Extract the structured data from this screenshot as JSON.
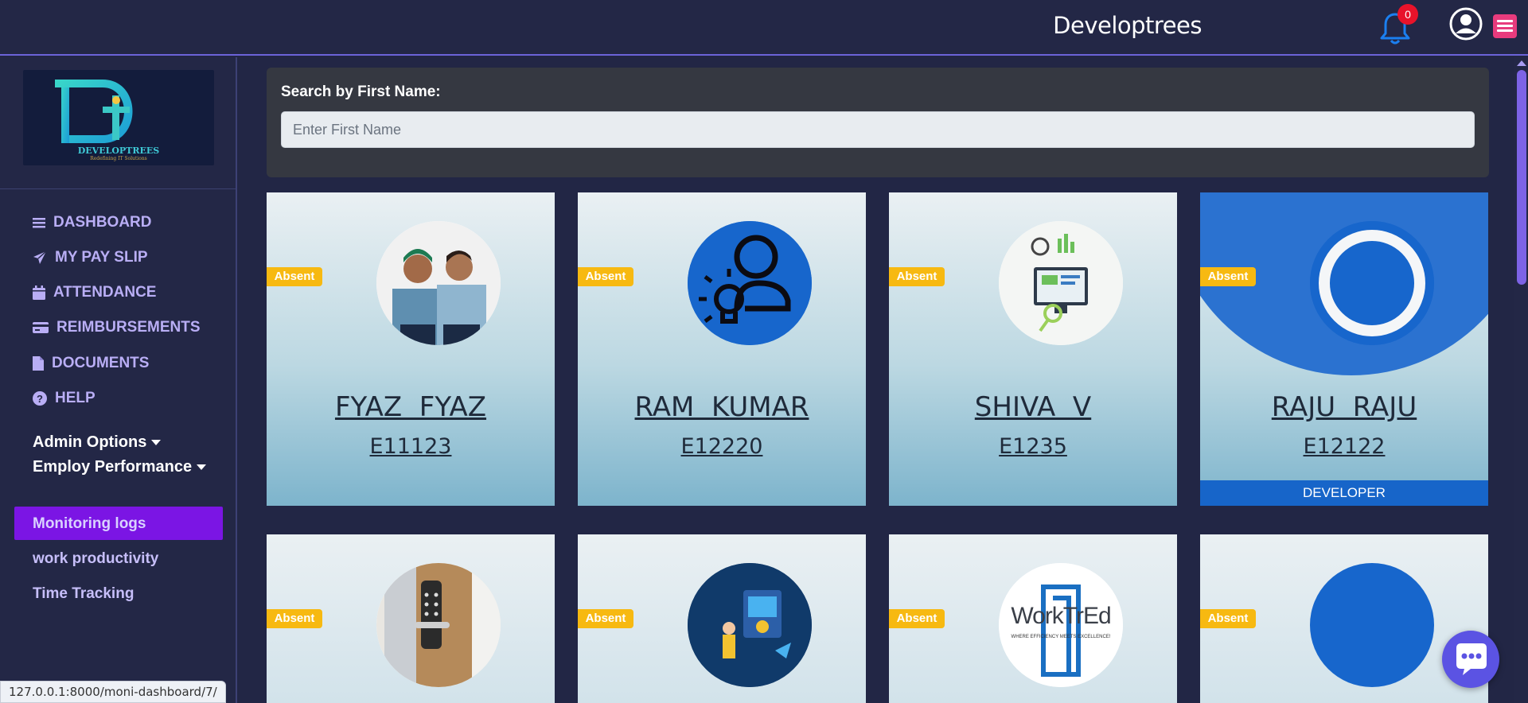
{
  "header": {
    "brand": "Developtrees",
    "notification_count": "0"
  },
  "logo": {
    "letters": "Dt",
    "wordmark": "DEVELOPTREES",
    "tagline": "Redefining IT Solutions"
  },
  "sidebar": {
    "nav": [
      {
        "label": "DASHBOARD",
        "icon": "menu-bars-icon"
      },
      {
        "label": "MY PAY SLIP",
        "icon": "paper-plane-icon"
      },
      {
        "label": "ATTENDANCE",
        "icon": "calendar-icon"
      },
      {
        "label": "REIMBURSEMENTS",
        "icon": "credit-card-icon"
      },
      {
        "label": "DOCUMENTS",
        "icon": "file-icon"
      },
      {
        "label": "HELP",
        "icon": "question-circle-icon"
      }
    ],
    "admin_options": "Admin Options",
    "employ_performance": "Employ Performance",
    "sub_items": [
      "Monitoring logs",
      "work productivity",
      "Time Tracking"
    ]
  },
  "search": {
    "label": "Search by First Name:",
    "placeholder": "Enter First Name",
    "value": ""
  },
  "employees": [
    {
      "name": "FYAZ  FYAZ",
      "id": "E11123",
      "status": "Absent",
      "role": ""
    },
    {
      "name": "RAM  KUMAR",
      "id": "E12220",
      "status": "Absent",
      "role": ""
    },
    {
      "name": "SHIVA  V",
      "id": "E1235",
      "status": "Absent",
      "role": ""
    },
    {
      "name": "RAJU  RAJU",
      "id": "E12122",
      "status": "Absent",
      "role": "DEVELOPER"
    },
    {
      "status": "Absent"
    },
    {
      "status": "Absent"
    },
    {
      "status": "Absent",
      "avatar_text": "WorkTrEd",
      "avatar_subtext": "WHERE EFFICIENCY MEETS EXCELLENCE!"
    },
    {
      "status": "Absent"
    }
  ],
  "statusbar": {
    "url": "127.0.0.1:8000/moni-dashboard/7/"
  },
  "colors": {
    "accent": "#7b15e4",
    "badge": "#f7b911",
    "bell": "#1b7ff0",
    "menu_button": "#e83b7d"
  }
}
